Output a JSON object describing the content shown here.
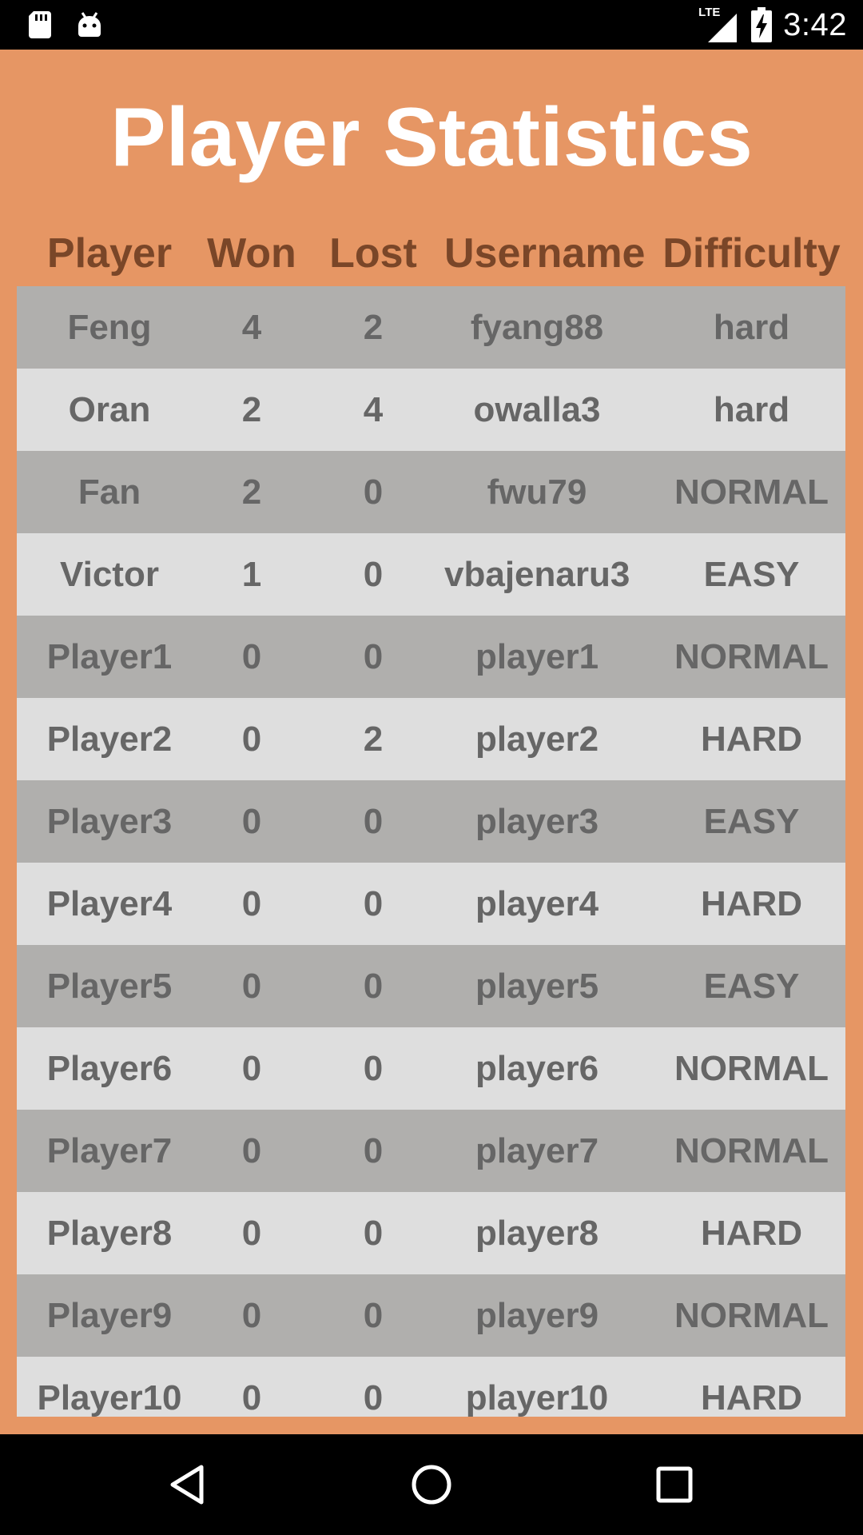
{
  "status_bar": {
    "time": "3:42",
    "network": "LTE",
    "icons": [
      "sd-card-icon",
      "android-icon",
      "signal-icon",
      "battery-charging-icon"
    ]
  },
  "title": "Player Statistics",
  "table": {
    "headers": [
      "Player",
      "Won",
      "Lost",
      "Username",
      "Difficulty"
    ],
    "rows": [
      {
        "player": "Feng",
        "won": "4",
        "lost": "2",
        "username": "fyang88",
        "difficulty": "hard"
      },
      {
        "player": "Oran",
        "won": "2",
        "lost": "4",
        "username": "owalla3",
        "difficulty": "hard"
      },
      {
        "player": "Fan",
        "won": "2",
        "lost": "0",
        "username": "fwu79",
        "difficulty": "NORMAL"
      },
      {
        "player": "Victor",
        "won": "1",
        "lost": "0",
        "username": "vbajenaru3",
        "difficulty": "EASY"
      },
      {
        "player": "Player1",
        "won": "0",
        "lost": "0",
        "username": "player1",
        "difficulty": "NORMAL"
      },
      {
        "player": "Player2",
        "won": "0",
        "lost": "2",
        "username": "player2",
        "difficulty": "HARD"
      },
      {
        "player": "Player3",
        "won": "0",
        "lost": "0",
        "username": "player3",
        "difficulty": "EASY"
      },
      {
        "player": "Player4",
        "won": "0",
        "lost": "0",
        "username": "player4",
        "difficulty": "HARD"
      },
      {
        "player": "Player5",
        "won": "0",
        "lost": "0",
        "username": "player5",
        "difficulty": "EASY"
      },
      {
        "player": "Player6",
        "won": "0",
        "lost": "0",
        "username": "player6",
        "difficulty": "NORMAL"
      },
      {
        "player": "Player7",
        "won": "0",
        "lost": "0",
        "username": "player7",
        "difficulty": "NORMAL"
      },
      {
        "player": "Player8",
        "won": "0",
        "lost": "0",
        "username": "player8",
        "difficulty": "HARD"
      },
      {
        "player": "Player9",
        "won": "0",
        "lost": "0",
        "username": "player9",
        "difficulty": "NORMAL"
      },
      {
        "player": "Player10",
        "won": "0",
        "lost": "0",
        "username": "player10",
        "difficulty": "HARD"
      }
    ]
  },
  "nav_bar": {
    "icons": [
      "back-icon",
      "home-icon",
      "recents-icon"
    ]
  },
  "colors": {
    "background": "#e69664",
    "header_text": "#7a4628",
    "row_dark": "#b0afad",
    "row_light": "#dedede",
    "cell_text": "#666666",
    "title_text": "#ffffff"
  }
}
